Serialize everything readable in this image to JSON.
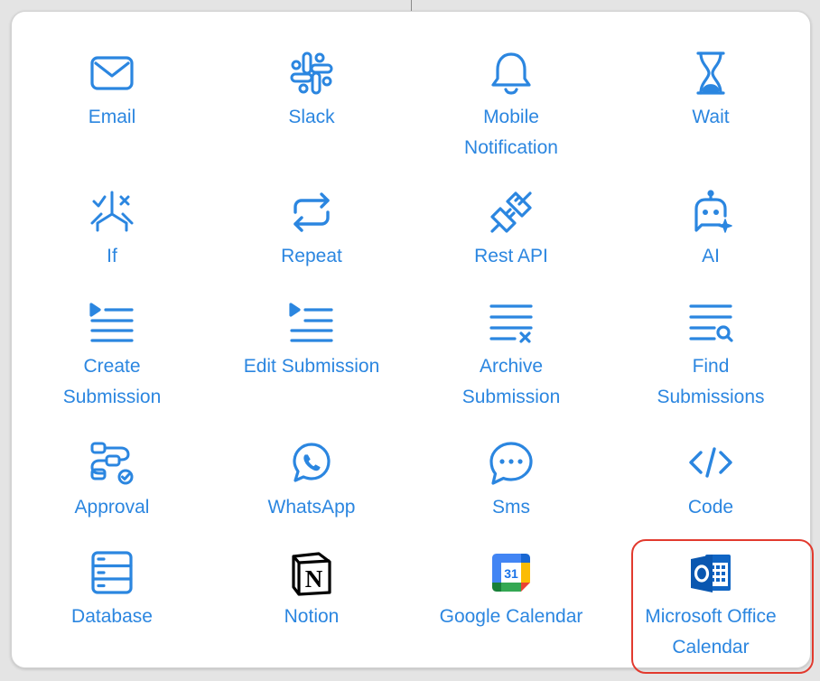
{
  "items": [
    {
      "label": "Email",
      "icon": "email-icon"
    },
    {
      "label": "Slack",
      "icon": "slack-icon"
    },
    {
      "label": "Mobile Notification",
      "icon": "bell-icon"
    },
    {
      "label": "Wait",
      "icon": "hourglass-icon"
    },
    {
      "label": "If",
      "icon": "branch-icon"
    },
    {
      "label": "Repeat",
      "icon": "repeat-icon"
    },
    {
      "label": "Rest API",
      "icon": "plug-icon"
    },
    {
      "label": "AI",
      "icon": "ai-bot-icon"
    },
    {
      "label": "Create Submission",
      "icon": "create-list-icon"
    },
    {
      "label": "Edit Submission",
      "icon": "edit-list-icon"
    },
    {
      "label": "Archive Submission",
      "icon": "archive-list-icon"
    },
    {
      "label": "Find Submissions",
      "icon": "find-list-icon"
    },
    {
      "label": "Approval",
      "icon": "approval-flow-icon"
    },
    {
      "label": "WhatsApp",
      "icon": "whatsapp-icon"
    },
    {
      "label": "Sms",
      "icon": "sms-bubble-icon"
    },
    {
      "label": "Code",
      "icon": "code-icon"
    },
    {
      "label": "Database",
      "icon": "database-icon"
    },
    {
      "label": "Notion",
      "icon": "notion-icon"
    },
    {
      "label": "Google Calendar",
      "icon": "google-calendar-icon"
    },
    {
      "label": "Microsoft Office Calendar",
      "icon": "outlook-calendar-icon"
    }
  ],
  "google_calendar_day": "31",
  "selected_item": "Microsoft Office Calendar",
  "colors": {
    "accent": "#2b86e0",
    "selection_border": "#e23a2e"
  }
}
